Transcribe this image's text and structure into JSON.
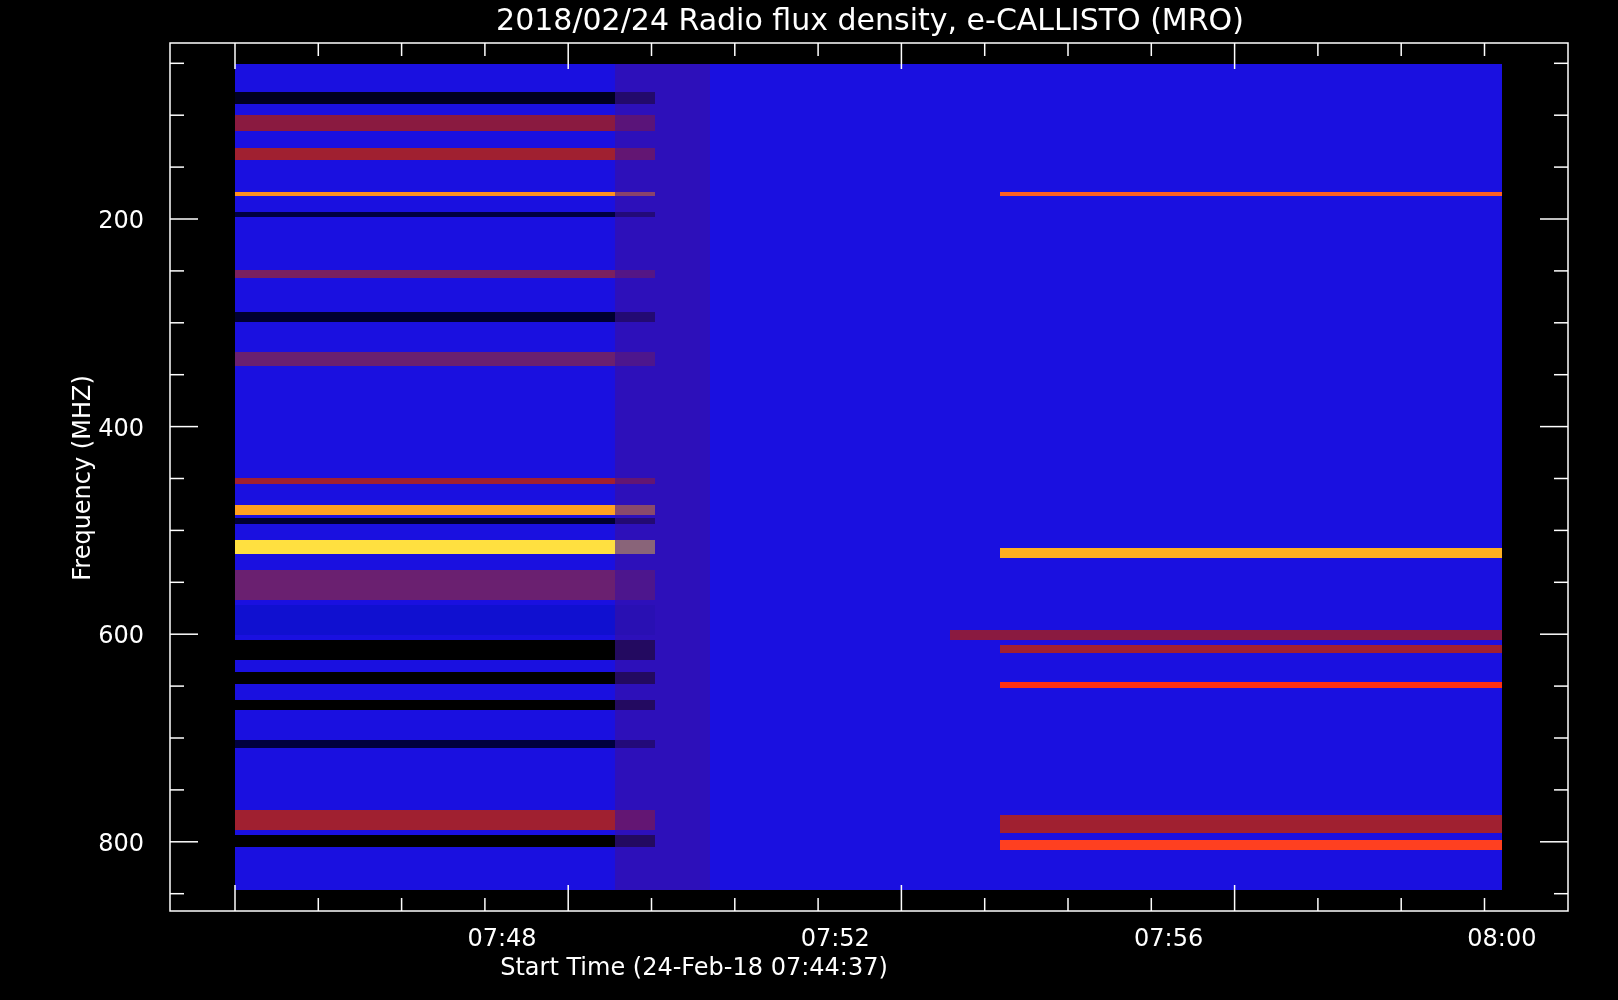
{
  "title": "2018/02/24  Radio flux density, e-CALLISTO (MRO)",
  "y_axis": {
    "label": "Frequency (MHZ)",
    "ticks": [
      "200",
      "400",
      "600",
      "800"
    ]
  },
  "x_axis": {
    "label": "Start Time (24-Feb-18 07:44:37)",
    "ticks": [
      "07:48",
      "07:52",
      "07:56",
      "08:00"
    ]
  }
}
